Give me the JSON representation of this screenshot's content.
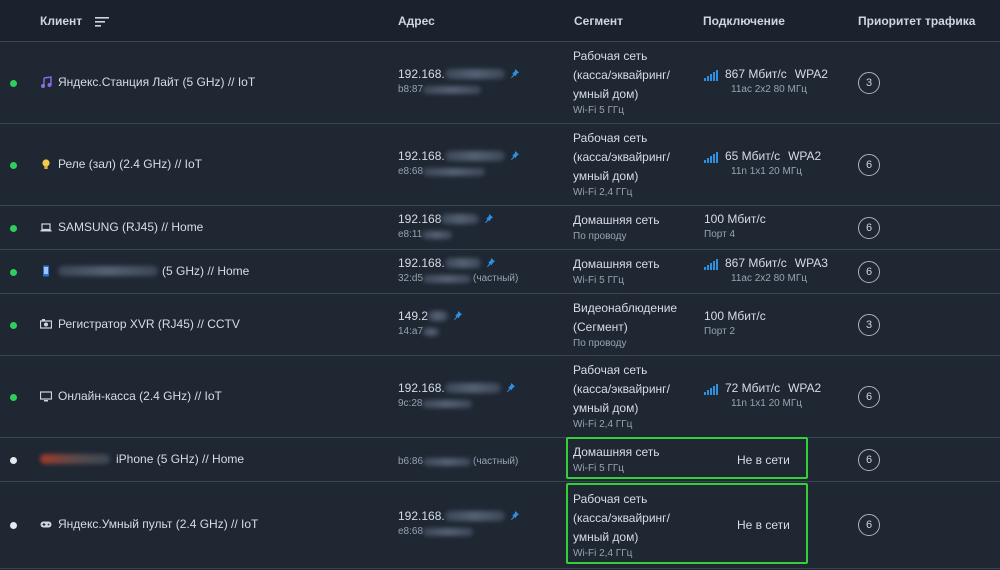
{
  "header": {
    "client": "Клиент",
    "address": "Адрес",
    "segment": "Сегмент",
    "connection": "Подключение",
    "priority": "Приоритет трафика"
  },
  "colors": {
    "online": "#2fcf5c",
    "offline": "#e6e9ee",
    "highlight": "#34d03a",
    "signal": "#2f8fe0"
  },
  "rows": [
    {
      "status": "online",
      "icon": "music-note-icon",
      "client": "Яндекс.Станция Лайт (5 GHz) // IoT",
      "ip": "192.168.",
      "mac": "b8:87",
      "mac_note": "",
      "segment": [
        "Рабочая сеть",
        "(касса/эквайринг/",
        "умный дом)"
      ],
      "segment_sub": "Wi-Fi 5 ГГц",
      "conn_type": "wifi",
      "speed": "867 Мбит/с",
      "security": "WPA2",
      "conn_sub": "11ac 2x2 80 МГц",
      "priority": "3"
    },
    {
      "status": "online",
      "icon": "lightbulb-icon",
      "client": "Реле (зал) (2.4 GHz) // IoT",
      "ip": "192.168.",
      "mac": "e8:68",
      "mac_note": "",
      "segment": [
        "Рабочая сеть",
        "(касса/эквайринг/",
        "умный дом)"
      ],
      "segment_sub": "Wi-Fi 2,4 ГГц",
      "conn_type": "wifi",
      "speed": "65 Мбит/с",
      "security": "WPA2",
      "conn_sub": "11n 1x1 20 МГц",
      "priority": "6"
    },
    {
      "status": "online",
      "icon": "laptop-icon",
      "client": "SAMSUNG (RJ45) // Home",
      "ip": "192.168",
      "mac": "e8:11",
      "mac_note": "",
      "segment": [
        "Домашняя сеть"
      ],
      "segment_sub": "По проводу",
      "conn_type": "wired",
      "speed": "100 Мбит/с",
      "security": "",
      "conn_sub": "Порт 4",
      "priority": "6"
    },
    {
      "status": "online",
      "icon": "phone-icon",
      "client": "(5 GHz) // Home",
      "ip": "192.168.",
      "mac": "32:d5",
      "mac_note": "(частный)",
      "segment": [
        "Домашняя сеть"
      ],
      "segment_sub": "Wi-Fi 5 ГГц",
      "conn_type": "wifi",
      "speed": "867 Мбит/с",
      "security": "WPA3",
      "conn_sub": "11ac 2x2 80 МГц",
      "priority": "6"
    },
    {
      "status": "online",
      "icon": "dvr-icon",
      "client": "Регистратор XVR (RJ45) // CCTV",
      "ip": "149.2",
      "mac": "14:a7",
      "mac_note": "",
      "segment": [
        "Видеонаблюдение",
        "(Сегмент)"
      ],
      "segment_sub": "По проводу",
      "conn_type": "wired",
      "speed": "100 Мбит/с",
      "security": "",
      "conn_sub": "Порт 2",
      "priority": "3"
    },
    {
      "status": "online",
      "icon": "monitor-icon",
      "client": "Онлайн-касса (2.4 GHz) // IoT",
      "ip": "192.168.",
      "mac": "9c:28",
      "mac_note": "",
      "segment": [
        "Рабочая сеть",
        "(касса/эквайринг/",
        "умный дом)"
      ],
      "segment_sub": "Wi-Fi 2,4 ГГц",
      "conn_type": "wifi",
      "speed": "72 Мбит/с",
      "security": "WPA2",
      "conn_sub": "11n 1x1 20 МГц",
      "priority": "6"
    },
    {
      "status": "offline",
      "icon": "avatar-icon",
      "client": "iPhone (5 GHz) // Home",
      "ip": "",
      "mac": "b6:86",
      "mac_note": "(частный)",
      "segment": [
        "Домашняя сеть"
      ],
      "segment_sub": "Wi-Fi 5 ГГц",
      "conn_type": "offline",
      "offline_text": "Не в сети",
      "priority": "6"
    },
    {
      "status": "offline",
      "icon": "gamepad-icon",
      "client": "Яндекс.Умный пульт (2.4 GHz) // IoT",
      "ip": "192.168.",
      "mac": "e8:68",
      "mac_note": "",
      "segment": [
        "Рабочая сеть",
        "(касса/эквайринг/",
        "умный дом)"
      ],
      "segment_sub": "Wi-Fi 2,4 ГГц",
      "conn_type": "offline",
      "offline_text": "Не в сети",
      "priority": "6"
    }
  ]
}
